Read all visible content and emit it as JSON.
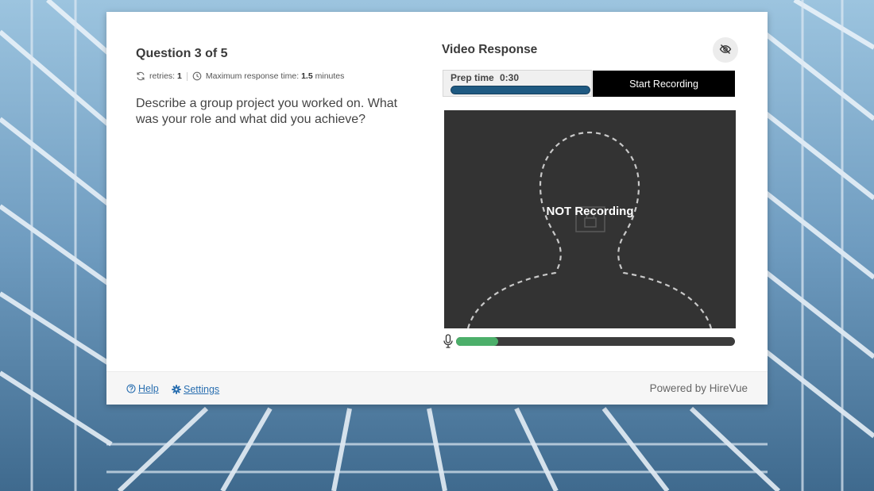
{
  "question": {
    "title": "Question 3 of 5",
    "retries_label": "retries:",
    "retries_value": "1",
    "max_time_label": "Maximum response time:",
    "max_time_value": "1.5",
    "max_time_unit": "minutes",
    "text": "Describe a group project you worked on. What was your role and what did you achieve?"
  },
  "video": {
    "title": "Video Response",
    "prep_label": "Prep time",
    "prep_time": "0:30",
    "prep_progress": 1.0,
    "start_label": "Start Recording",
    "status": "NOT Recording",
    "mic_level": 0.15
  },
  "footer": {
    "help_label": "Help",
    "settings_label": "Settings",
    "powered_by": "Powered by HireVue"
  },
  "colors": {
    "accent": "#1f5a82",
    "mic_level": "#4caf6a",
    "link": "#2a6fb0",
    "video_bg": "#333333"
  },
  "icons": [
    "retry-icon",
    "clock-icon",
    "eye-off-icon",
    "lock-icon",
    "microphone-icon",
    "help-circle-icon",
    "gear-icon"
  ]
}
